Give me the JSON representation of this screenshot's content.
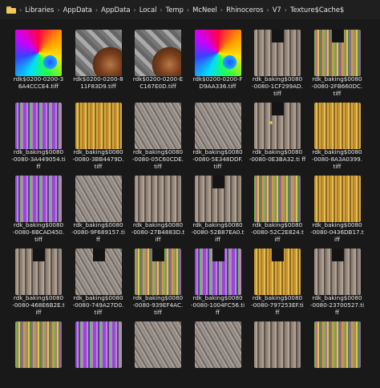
{
  "breadcrumbs": [
    "Libraries",
    "AppData",
    "AppData",
    "Local",
    "Temp",
    "McNeel",
    "Rhinoceros",
    "V7",
    "Texture$Cache$"
  ],
  "separator": "›",
  "items": [
    {
      "label": "rdk$0200-0200-3 6A4CCCE4.tiff",
      "pattern": "p-rainbow",
      "gap": false
    },
    {
      "label": "rdk$0200-0200-8 11F83D9.tiff",
      "pattern": "p-wood",
      "gap": false
    },
    {
      "label": "rdk$0200-0200-E C167E0D.tiff",
      "pattern": "p-wood",
      "gap": false
    },
    {
      "label": "rdk$0200-0200-F D9AA336.tiff",
      "pattern": "p-rainbow",
      "gap": false
    },
    {
      "label": "rdk_baking$0080 -0080-1CF299AD. tiff",
      "pattern": "p-tan",
      "gap": true
    },
    {
      "label": "rdk_baking$0080 -0080-2FB660DC. tiff",
      "pattern": "p-mix",
      "gap": true
    },
    {
      "label": "rdk_baking$0080 -0080-3A449054.ti ff",
      "pattern": "p-purple",
      "gap": false
    },
    {
      "label": "rdk_baking$0080 -0080-3BB4479D. tiff",
      "pattern": "p-gold",
      "gap": false
    },
    {
      "label": "rdk_baking$0080 -0080-05C60CDE. tiff",
      "pattern": "p-grey",
      "gap": false
    },
    {
      "label": "rdk_baking$0080 -0080-5E348DDF. tiff",
      "pattern": "p-grey",
      "gap": false
    },
    {
      "label": "rdk_baking$0080 -0080-0E3BA32.ti ff",
      "pattern": "p-tan",
      "gap": true,
      "dot": true
    },
    {
      "label": "rdk_baking$0080 -0080-8A3A0399. tiff",
      "pattern": "p-gold",
      "gap": false
    },
    {
      "label": "rdk_baking$0080 -0080-8BCAD450. tiff",
      "pattern": "p-purple",
      "gap": false
    },
    {
      "label": "rdk_baking$0080 -0080-9F689157.ti ff",
      "pattern": "p-grey",
      "gap": false
    },
    {
      "label": "rdk_baking$0080 -0080-27B4883D.t iff",
      "pattern": "p-tan",
      "gap": false
    },
    {
      "label": "rdk_baking$0080 -0080-52B87EA0.t iff",
      "pattern": "p-tan",
      "gap": true
    },
    {
      "label": "rdk_baking$0080 -0080-52C2E824.t iff",
      "pattern": "p-mix",
      "gap": false
    },
    {
      "label": "rdk_baking$0080 -0080-0436DB17.t iff",
      "pattern": "p-gold",
      "gap": false
    },
    {
      "label": "rdk_baking$0080 -0080-468E6B2E.t iff",
      "pattern": "p-tan",
      "gap": true
    },
    {
      "label": "rdk_baking$0080 -0080-749A27D0. tiff",
      "pattern": "p-grey",
      "gap": true
    },
    {
      "label": "rdk_baking$0080 -0080-939EF4AC. tiff",
      "pattern": "p-mix",
      "gap": true
    },
    {
      "label": "rdk_baking$0080 -0080-1004FC56.ti ff",
      "pattern": "p-purple",
      "gap": true
    },
    {
      "label": "rdk_baking$0080 -0080-797253EF.ti ff",
      "pattern": "p-gold",
      "gap": true
    },
    {
      "label": "rdk_baking$0080 -0080-23700527.ti ff",
      "pattern": "p-tan",
      "gap": true
    },
    {
      "label": "",
      "pattern": "p-mix",
      "gap": false
    },
    {
      "label": "",
      "pattern": "p-purple",
      "gap": false
    },
    {
      "label": "",
      "pattern": "p-grey",
      "gap": false
    },
    {
      "label": "",
      "pattern": "p-grey",
      "gap": false
    },
    {
      "label": "",
      "pattern": "p-tan",
      "gap": false
    },
    {
      "label": "",
      "pattern": "p-mix",
      "gap": false
    }
  ]
}
